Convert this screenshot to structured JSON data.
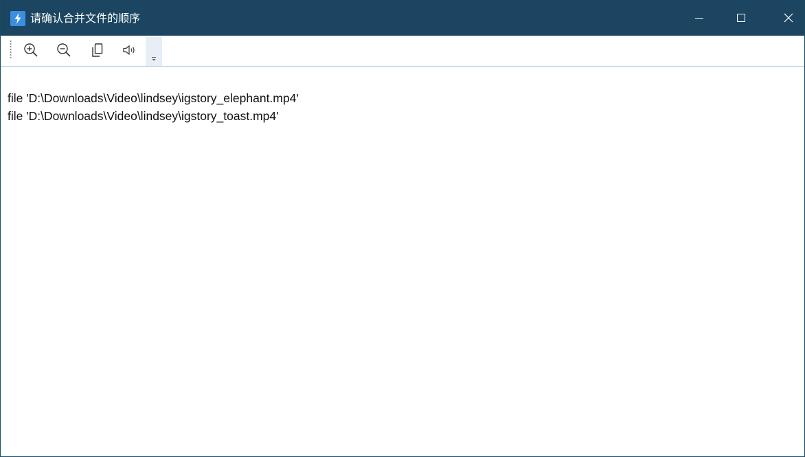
{
  "window": {
    "title": "请确认合并文件的顺序",
    "app_icon": "lightning-icon",
    "controls": [
      "minimize-icon",
      "maximize-icon",
      "close-icon"
    ]
  },
  "toolbar": {
    "buttons": [
      {
        "name": "zoom-in",
        "icon": "zoom-in-icon"
      },
      {
        "name": "zoom-out",
        "icon": "zoom-out-icon"
      },
      {
        "name": "copy",
        "icon": "copy-icon"
      },
      {
        "name": "read-aloud",
        "icon": "speaker-icon"
      }
    ],
    "overflow_icon": "overflow-chevron-icon"
  },
  "content": {
    "lines": [
      "file 'D:\\Downloads\\Video\\lindsey\\igstory_elephant.mp4'",
      "file 'D:\\Downloads\\Video\\lindsey\\igstory_toast.mp4'"
    ]
  },
  "colors": {
    "titlebar": "#1b4560",
    "app_icon_bg": "#3b8fe0",
    "toolbar_separator": "#a9c3d6",
    "overflow_bg": "#e7eef5"
  }
}
